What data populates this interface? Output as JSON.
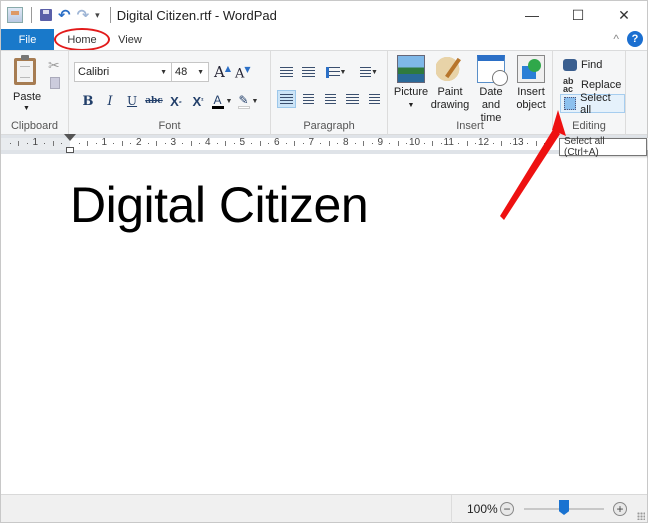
{
  "window": {
    "title": "Digital Citizen.rtf - WordPad",
    "controls": {
      "minimize": "—",
      "maximize": "☐",
      "close": "✕"
    }
  },
  "quick_access": {
    "icons": [
      "app-icon",
      "save-icon",
      "undo-icon",
      "redo-icon",
      "customize-icon"
    ],
    "undo_glyph": "↶",
    "redo_glyph": "↷",
    "more_glyph": "▾"
  },
  "tabs": [
    {
      "label": "File",
      "active": false
    },
    {
      "label": "Home",
      "active": true,
      "highlighted": true
    },
    {
      "label": "View",
      "active": false
    }
  ],
  "tabs_right": {
    "collapse_glyph": "^",
    "help_glyph": "?"
  },
  "ribbon": {
    "clipboard": {
      "label": "Clipboard",
      "paste_label": "Paste",
      "cut_glyph": "✂"
    },
    "font": {
      "label": "Font",
      "family": "Calibri",
      "size": "48",
      "grow_glyph": "A",
      "shrink_glyph": "A",
      "bold": "B",
      "italic": "I",
      "underline": "U",
      "strikethrough": "abc",
      "subscript": "X",
      "superscript": "X",
      "text_color_glyph": "A",
      "text_color": "#000000",
      "highlight_glyph": "✎"
    },
    "paragraph": {
      "label": "Paragraph",
      "alignment_selected": "left"
    },
    "insert": {
      "label": "Insert",
      "picture": "Picture",
      "paint_line1": "Paint",
      "paint_line2": "drawing",
      "date_line1": "Date and",
      "date_line2": "time",
      "object_line1": "Insert",
      "object_line2": "object"
    },
    "editing": {
      "label": "Editing",
      "find": "Find",
      "replace": "Replace",
      "replace_glyph": "ab\nac",
      "select_all": "Select all"
    }
  },
  "ruler": {
    "left_numbers": [
      "1"
    ],
    "numbers": [
      "1",
      "2",
      "3",
      "4",
      "5",
      "6",
      "7",
      "8",
      "9",
      "10",
      "11",
      "12",
      "13"
    ]
  },
  "tooltip": "Select all (Ctrl+A)",
  "document": {
    "text": "Digital Citizen",
    "font_size_pt": 48
  },
  "annotations": {
    "highlight_color": "#e21b1b",
    "arrow_target": "Select all"
  },
  "statusbar": {
    "zoom": "100%",
    "zoom_out_glyph": "−",
    "zoom_in_glyph": "+",
    "zoom_level_fraction": 0.5
  },
  "colors": {
    "file_tab": "#1979ca",
    "help": "#1b6fd0",
    "zoom_thumb": "#1a73d1",
    "selection": "#cce4f7"
  }
}
